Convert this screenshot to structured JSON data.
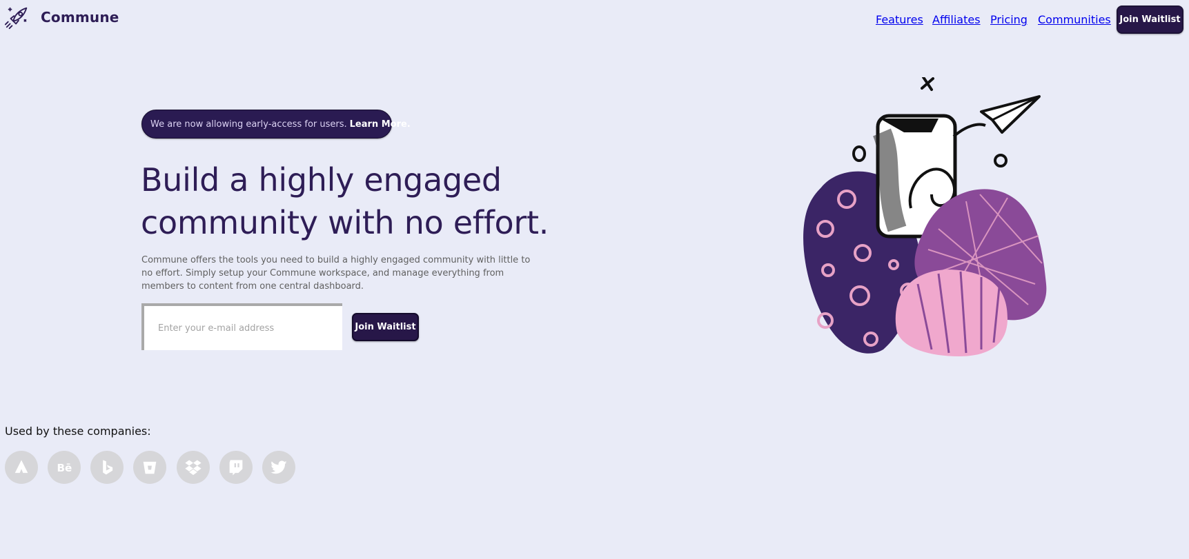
{
  "header": {
    "brand": "Commune",
    "logo_icon": "rocket-icon",
    "nav": [
      "Features",
      "Affiliates",
      "Pricing",
      "Communities"
    ],
    "cta_label": "Join Waitlist"
  },
  "hero": {
    "banner_text": "We are now allowing early-access for users.",
    "banner_link": "Learn More.",
    "headline_line1": "Build a highly engaged",
    "headline_line2": "community with no effort.",
    "description": "Commune offers the tools you need to build a highly engaged community with little to no effort. Simply setup your Commune workspace, and manage everything from members to content from one central dashboard.",
    "email_placeholder": "Enter your e-mail address",
    "join_label": "Join Waitlist",
    "illustration_icon": "phone-paper-plane-illustration"
  },
  "companies": {
    "heading": "Used by these companies:",
    "logos": [
      "atlassian-icon",
      "behance-icon",
      "bing-icon",
      "bitbucket-icon",
      "dropbox-icon",
      "twitch-icon",
      "twitter-icon"
    ]
  },
  "colors": {
    "background": "#e9ebf7",
    "primary": "#271748",
    "heading": "#2e1d56",
    "logo_bg": "#d6d6d9"
  }
}
